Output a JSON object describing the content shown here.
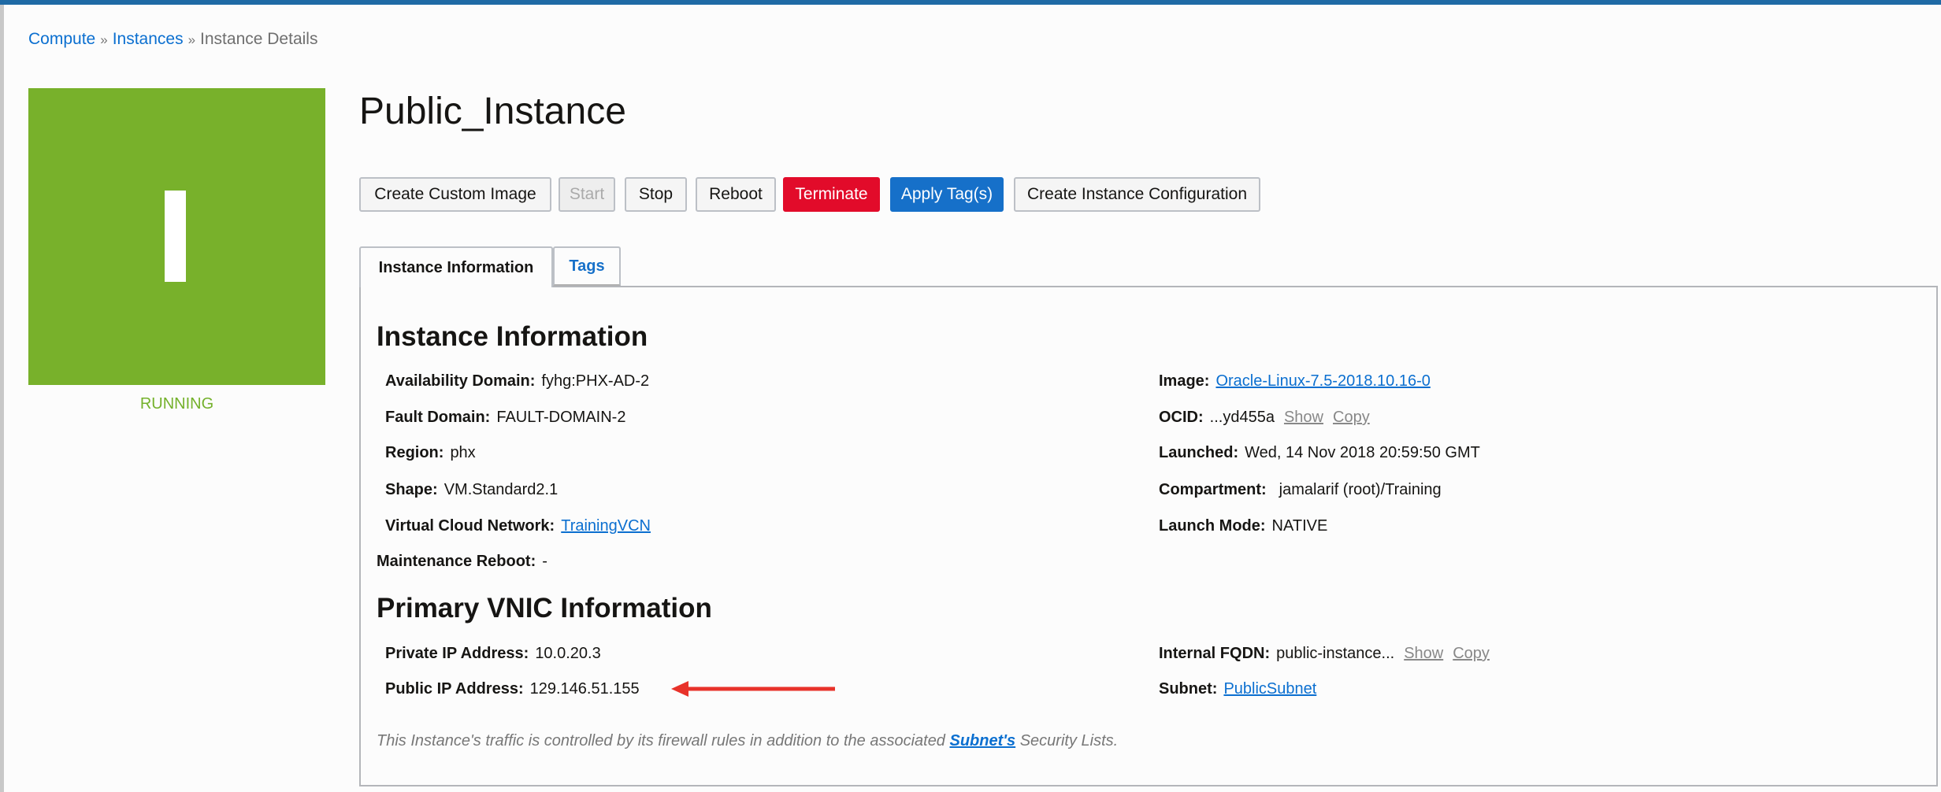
{
  "breadcrumb": {
    "items": [
      "Compute",
      "Instances"
    ],
    "separator": "»",
    "current": "Instance Details"
  },
  "instance": {
    "icon_letter": "I",
    "status": "RUNNING",
    "title": "Public_Instance"
  },
  "actions": [
    "Create Custom Image",
    "Start",
    "Stop",
    "Reboot",
    "Terminate",
    "Apply Tag(s)",
    "Create Instance Configuration"
  ],
  "tabs": [
    "Instance Information",
    "Tags"
  ],
  "instance_info": {
    "heading": "Instance Information",
    "left": [
      {
        "label": "Availability Domain:",
        "value": "fyhg:PHX-AD-2"
      },
      {
        "label": "Fault Domain:",
        "value": "FAULT-DOMAIN-2"
      },
      {
        "label": "Region:",
        "value": "phx"
      },
      {
        "label": "Shape:",
        "value": "VM.Standard2.1"
      },
      {
        "label": "Virtual Cloud Network:",
        "value": "TrainingVCN"
      }
    ],
    "maintenance": {
      "label": "Maintenance Reboot:",
      "value": "-"
    },
    "right": [
      {
        "label": "Image:",
        "value": "Oracle-Linux-7.5-2018.10.16-0"
      },
      {
        "label": "OCID:",
        "value": "...yd455a",
        "show": "Show",
        "copy": "Copy"
      },
      {
        "label": "Launched:",
        "value": "Wed, 14 Nov 2018 20:59:50 GMT"
      },
      {
        "label": "Compartment:",
        "value": "jamalarif (root)/Training"
      },
      {
        "label": "Launch Mode:",
        "value": "NATIVE"
      }
    ]
  },
  "vnic": {
    "heading": "Primary VNIC Information",
    "private_ip": {
      "label": "Private IP Address:",
      "value": "10.0.20.3"
    },
    "public_ip": {
      "label": "Public IP Address:",
      "value": "129.146.51.155"
    },
    "fqdn": {
      "label": "Internal FQDN:",
      "value": "public-instance...",
      "show": "Show",
      "copy": "Copy"
    },
    "subnet": {
      "label": "Subnet:",
      "value": "PublicSubnet"
    },
    "note": {
      "before": "This Instance's traffic is controlled by its firewall rules in addition to the associated",
      "link": "Subnet's",
      "after": "Security Lists."
    }
  },
  "colors": {
    "running": "#78b12b",
    "terminate": "#e20b2a",
    "apply": "#1670c9",
    "arrow": "#e8322a"
  }
}
